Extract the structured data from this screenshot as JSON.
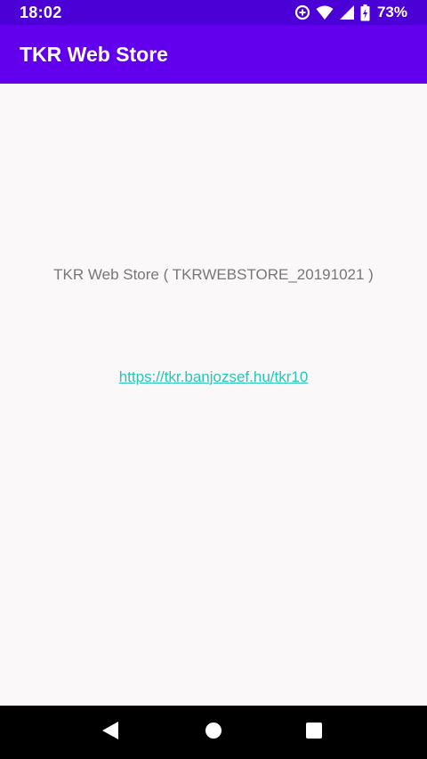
{
  "status_bar": {
    "time": "18:02",
    "battery_percent": "73%",
    "icons": [
      "data-saver-icon",
      "wifi-icon",
      "cell-signal-icon",
      "battery-icon"
    ]
  },
  "app_bar": {
    "title": "TKR Web Store"
  },
  "main": {
    "info_text": "TKR Web Store ( TKRWEBSTORE_20191021 )",
    "link_text": "https://tkr.banjozsef.hu/tkr10"
  },
  "nav_bar": {
    "buttons": [
      "back-icon",
      "home-icon",
      "recents-icon"
    ]
  },
  "colors": {
    "status_bar": "#4B00D6",
    "app_bar": "#6200EE",
    "background": "#FAF8F8",
    "link": "#26C6B8",
    "info_text": "#777777"
  }
}
